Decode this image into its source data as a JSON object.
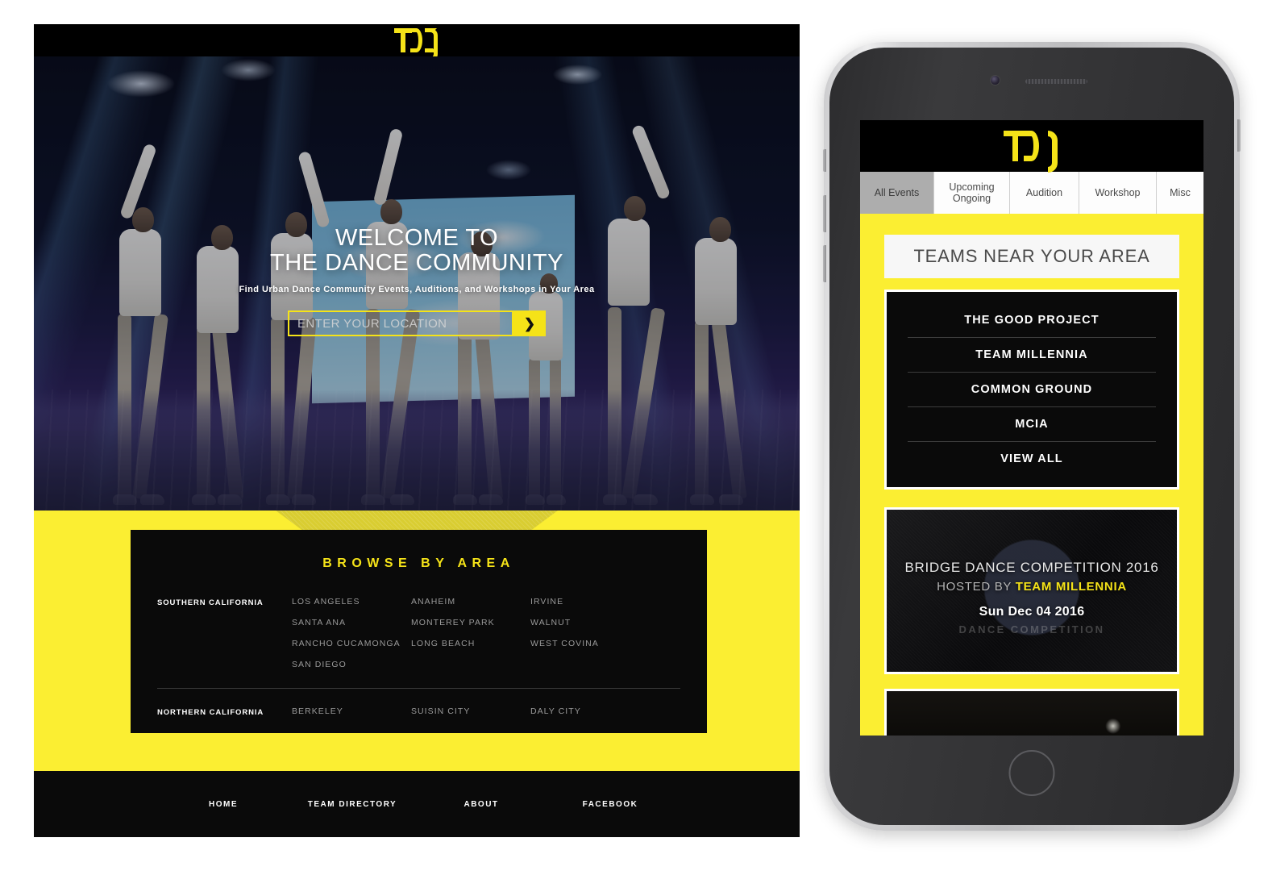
{
  "brand": {
    "logo_text": "TDC",
    "yellow": "#F5E318",
    "bg_yellow": "#FBEE32",
    "black": "#0a0a0a"
  },
  "desktop": {
    "hero": {
      "title_line1": "WELCOME TO",
      "title_line2": "THE DANCE COMMUNITY",
      "subtitle": "Find Urban Dance Community Events, Auditions, and Workshops in Your Area",
      "search_placeholder": "ENTER YOUR LOCATION",
      "search_value": "",
      "go_icon": "chevron-right-icon",
      "go_label": "❯"
    },
    "browse": {
      "title": "BROWSE BY AREA",
      "regions": [
        {
          "name": "SOUTHERN CALIFORNIA",
          "columns": [
            [
              "LOS ANGELES",
              "SANTA ANA",
              "RANCHO CUCAMONGA",
              "SAN DIEGO"
            ],
            [
              "ANAHEIM",
              "MONTEREY PARK",
              "LONG BEACH"
            ],
            [
              "IRVINE",
              "WALNUT",
              "WEST COVINA"
            ]
          ]
        },
        {
          "name": "NORTHERN CALIFORNIA",
          "columns": [
            [
              "BERKELEY"
            ],
            [
              "SUISIN CITY"
            ],
            [
              "DALY CITY"
            ]
          ]
        }
      ]
    },
    "footer": {
      "links": [
        "HOME",
        "TEAM DIRECTORY",
        "ABOUT",
        "FACEBOOK"
      ]
    }
  },
  "phone": {
    "tabs": [
      {
        "label": "All Events",
        "active": true
      },
      {
        "label": "Upcoming Ongoing",
        "active": false
      },
      {
        "label": "Audition",
        "active": false
      },
      {
        "label": "Workshop",
        "active": false
      },
      {
        "label": "Misc",
        "active": false
      }
    ],
    "teams_header": "TEAMS NEAR YOUR AREA",
    "teams": [
      "THE GOOD PROJECT",
      "TEAM MILLENNIA",
      "COMMON GROUND",
      "MCIA",
      "VIEW ALL"
    ],
    "events": [
      {
        "title": "BRIDGE DANCE COMPETITION 2016",
        "hosted_by_label": "HOSTED BY ",
        "host": "TEAM MILLENNIA",
        "date": "Sun Dec 04 2016",
        "watermark": "DANCE COMPETITION"
      }
    ]
  }
}
